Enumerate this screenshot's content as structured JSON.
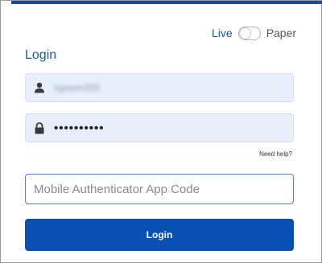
{
  "mode": {
    "live_label": "Live",
    "paper_label": "Paper"
  },
  "login": {
    "title": "Login",
    "username": {
      "value": "sgreen203",
      "icon": "user-icon"
    },
    "password": {
      "masked_value": "••••••••••",
      "icon": "lock-icon"
    },
    "help_link": "Need help?",
    "authenticator": {
      "placeholder": "Mobile Authenticator App Code",
      "value": ""
    },
    "submit_label": "Login"
  },
  "colors": {
    "accent": "#1d57a5",
    "button": "#0b4fb3",
    "field_bg": "#e8effc",
    "top_bar": "#1d4c97"
  }
}
